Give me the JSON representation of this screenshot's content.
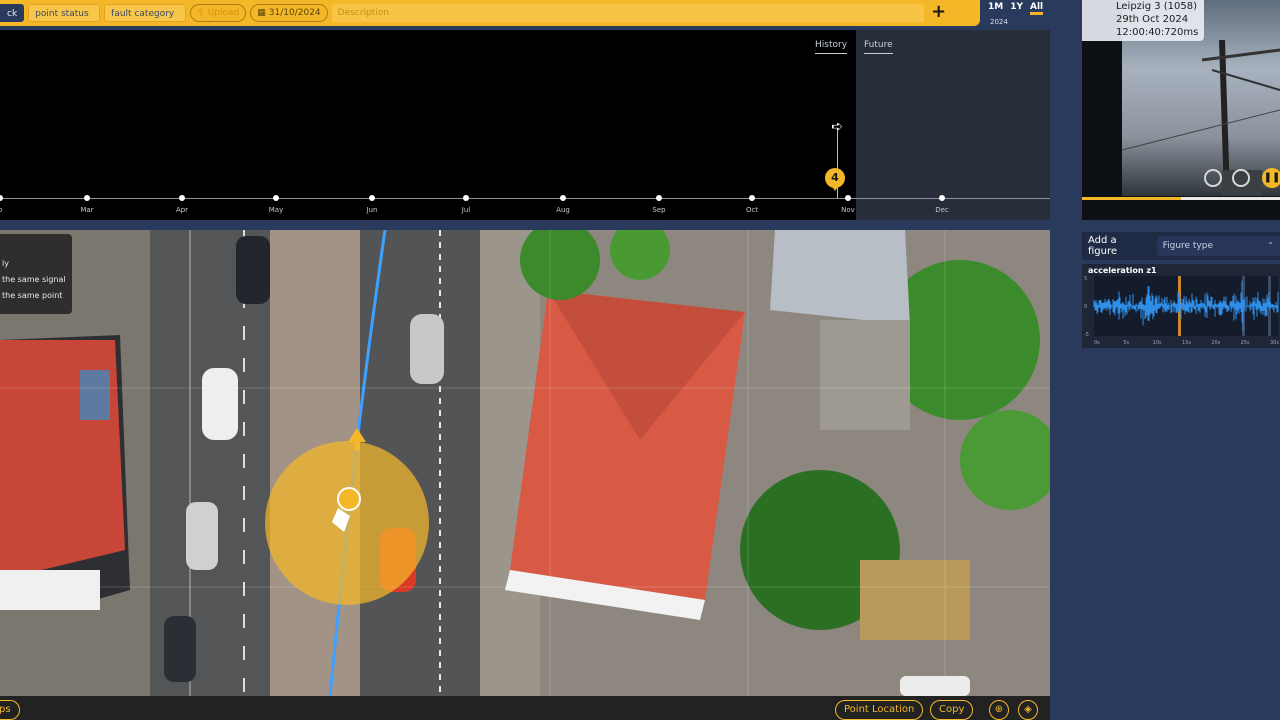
{
  "toolbar": {
    "track_partial": "ck",
    "point_status": "point status",
    "fault_category": "fault category",
    "upload_label": "Upload",
    "date": "31/10/2024",
    "description_placeholder": "Description",
    "add_label": "+"
  },
  "range_buttons": [
    "1M",
    "1Y",
    "All"
  ],
  "range_selected": "All",
  "year_label": "2024",
  "timeline": {
    "history_label": "History",
    "future_label": "Future",
    "months": [
      "b",
      "Mar",
      "Apr",
      "May",
      "Jun",
      "Jul",
      "Aug",
      "Sep",
      "Oct",
      "Nov",
      "Dec"
    ],
    "badge_count": "4",
    "arrow_icon": "export-arrow-icon"
  },
  "context_menu": {
    "items": [
      "ly",
      "the same signal",
      "the same point"
    ]
  },
  "bottom": {
    "left_button_partial": "ps",
    "point_location": "Point Location",
    "copy": "Copy",
    "locate_icon": "crosshair-icon",
    "navigate_icon": "navigation-diamond-icon"
  },
  "video": {
    "line1": "Leipzig 3 (1058)",
    "line2": "29th Oct 2024",
    "line3": "12:00:40:720ms",
    "progress": 0.5
  },
  "figure": {
    "label": "Add a figure",
    "select_placeholder": "Figure type"
  },
  "signal_chart": {
    "title": "acceleration z1",
    "y_ticks": [
      "5",
      "0",
      "-5"
    ],
    "x_ticks": [
      "0s",
      "5s",
      "10s",
      "15s",
      "20s",
      "25s",
      "30s"
    ]
  },
  "colors": {
    "accent": "#f4b728",
    "panel": "#2a3a5c",
    "signal": "#2f8fe8"
  }
}
